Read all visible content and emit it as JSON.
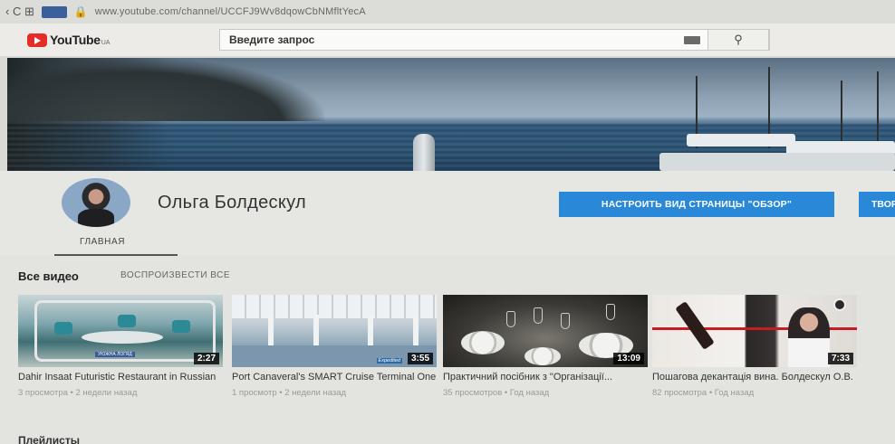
{
  "browser": {
    "nav_icons": "‹  C  ⊞",
    "security_label": "",
    "lock_icon": "🔒",
    "url": "www.youtube.com/channel/UCCFJ9Wv8dqowCbNMfltYecA"
  },
  "masthead": {
    "brand": "YouTube",
    "region": "UA",
    "search_placeholder": "Введите запрос",
    "search_icon": "⚲"
  },
  "channel": {
    "name": "Ольга Болдескул",
    "customize_button": "НАСТРОИТЬ ВИД СТРАНИЦЫ \"ОБЗОР\"",
    "studio_button": "ТВОРЧЕСКАЯ СТУДИЯ",
    "tab_home": "ГЛАВНАЯ"
  },
  "section": {
    "title": "Все видео",
    "play_all": "ВОСПРОИЗВЕСТИ ВСЕ"
  },
  "videos": [
    {
      "title": "Dahir Insaat Futuristic Restaurant in Russian",
      "duration": "2:27",
      "meta": "3 просмотра • 2 недели назад",
      "thumb_caption": "УЮЖНА ЛОГЯД"
    },
    {
      "title": "Port Canaveral's SMART Cruise Terminal One",
      "duration": "3:55",
      "meta": "1 просмотр • 2 недели назад",
      "thumb_caption": "Expedited"
    },
    {
      "title": "Практичний посібник з \"Організації...",
      "duration": "13:09",
      "meta": "35 просмотров • Год назад"
    },
    {
      "title": "Пошагова декантація вина. Болдескул О.В.",
      "duration": "7:33",
      "meta": "82 просмотра • Год назад"
    }
  ],
  "next_section_title": "Плейлисты"
}
